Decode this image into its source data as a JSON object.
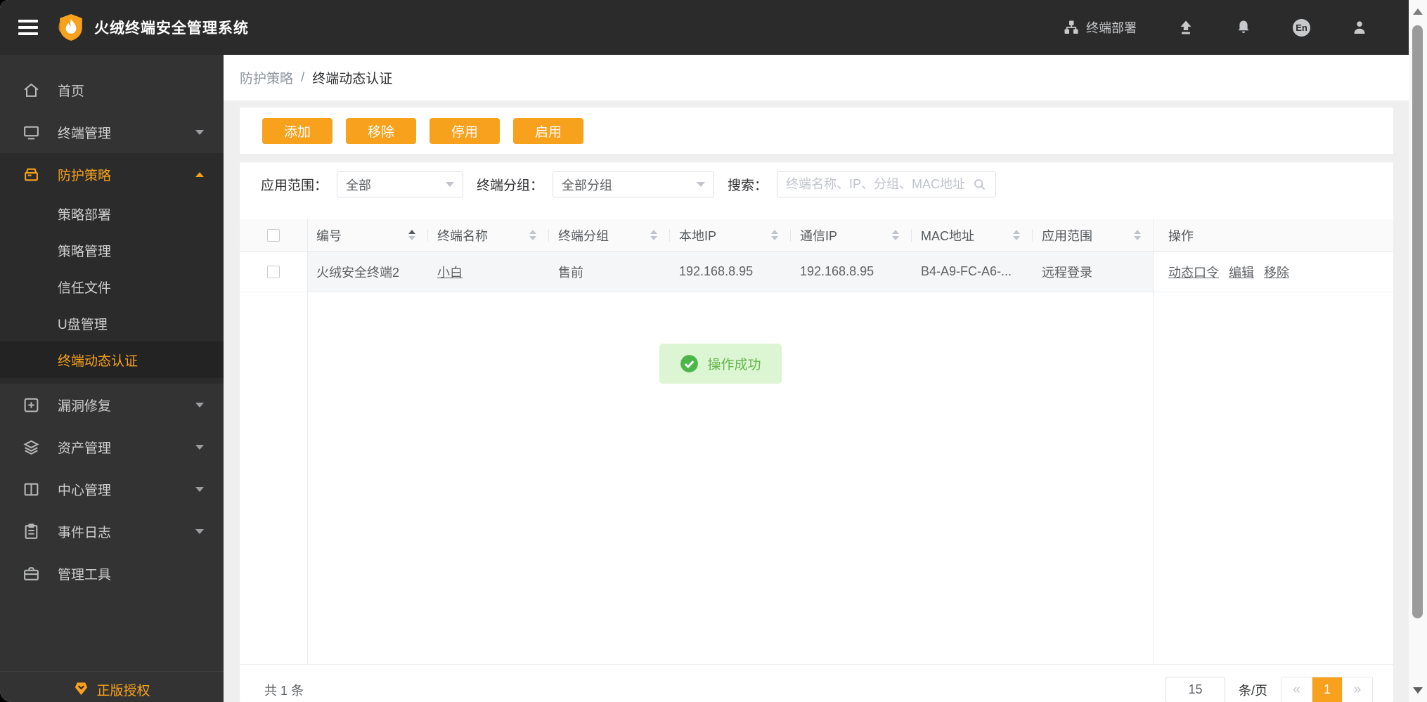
{
  "topbar": {
    "title": "火绒终端安全管理系统",
    "deploy": "终端部署",
    "lang": "En"
  },
  "sidebar": {
    "items": [
      {
        "label": "首页"
      },
      {
        "label": "终端管理"
      },
      {
        "label": "防护策略"
      },
      {
        "label": "漏洞修复"
      },
      {
        "label": "资产管理"
      },
      {
        "label": "中心管理"
      },
      {
        "label": "事件日志"
      },
      {
        "label": "管理工具"
      }
    ],
    "submenu": [
      {
        "label": "策略部署"
      },
      {
        "label": "策略管理"
      },
      {
        "label": "信任文件"
      },
      {
        "label": "U盘管理"
      },
      {
        "label": "终端动态认证"
      }
    ],
    "license": "正版授权"
  },
  "breadcrumb": {
    "parent": "防护策略",
    "separator": "/",
    "current": "终端动态认证"
  },
  "toolbar": {
    "add": "添加",
    "remove": "移除",
    "disable": "停用",
    "enable": "启用"
  },
  "filters": {
    "scope_label": "应用范围：",
    "scope_value": "全部",
    "group_label": "终端分组：",
    "group_value": "全部分组",
    "search_label": "搜索：",
    "search_placeholder": "终端名称、IP、分组、MAC地址"
  },
  "table": {
    "headers": [
      "编号",
      "终端名称",
      "终端分组",
      "本地IP",
      "通信IP",
      "MAC地址",
      "应用范围",
      "操作"
    ],
    "row": {
      "id_name": "火绒安全终端2",
      "terminal": "小白",
      "group": "售前",
      "local_ip": "192.168.8.95",
      "comm_ip": "192.168.8.95",
      "mac": "B4-A9-FC-A6-...",
      "scope": "远程登录",
      "action_otp": "动态口令",
      "action_edit": "编辑",
      "action_remove": "移除"
    }
  },
  "toast": {
    "message": "操作成功"
  },
  "footer": {
    "total": "共 1 条",
    "page_size": "15",
    "per_page": "条/页",
    "prev": "«",
    "page": "1",
    "next": "»"
  },
  "colors": {
    "accent": "#F7A11C",
    "success": "#4CB748",
    "success_bg": "#DCF5D3",
    "dark": "#2B2B2B"
  }
}
